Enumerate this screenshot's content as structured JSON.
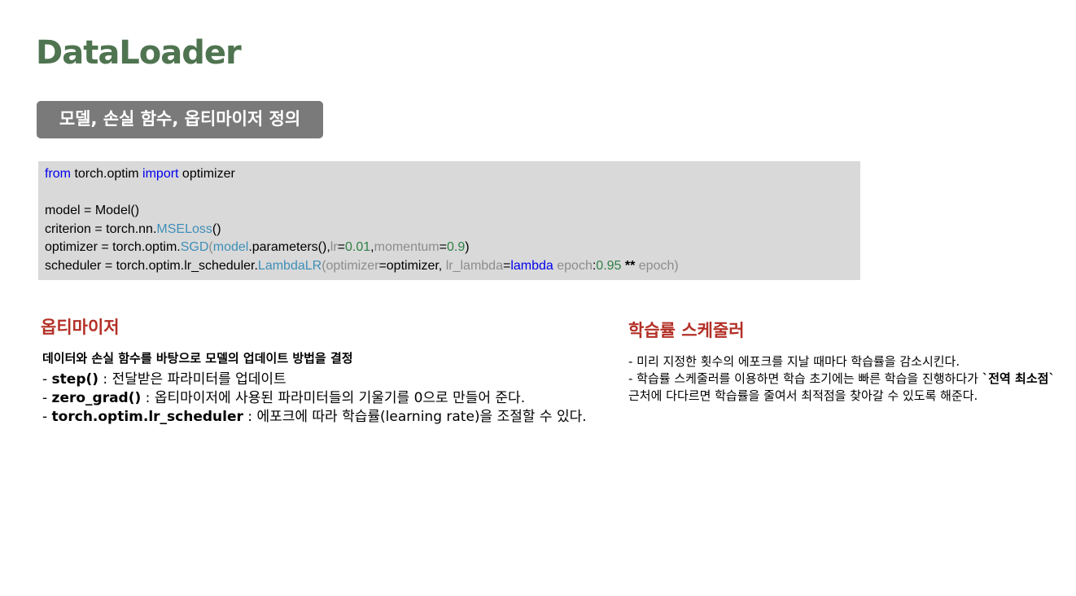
{
  "slide": {
    "title": "DataLoader",
    "badge": "모델, 손실 함수, 옵티마이저 정의"
  },
  "code": {
    "line1": {
      "kw_from": "from",
      "mod": " torch.optim ",
      "kw_import": "import",
      "name": " optimizer"
    },
    "line2": {
      "lhs": "model = Model()"
    },
    "line3": {
      "lhs": "criterion = torch.nn.",
      "fn": "MSELoss",
      "rest": "()"
    },
    "line4": {
      "lhs": "optimizer = torch.optim.",
      "fn": "SGD",
      "open": "(",
      "p_model": "model",
      "mid": ".parameters(),",
      "p_lr": "lr",
      "eq1": "=",
      "v_lr": "0.01",
      "comma": ",",
      "p_mom": "momentum",
      "eq2": "=",
      "v_mom": "0.9",
      "close": ")"
    },
    "line5": {
      "lhs": "scheduler = torch.optim.lr_scheduler.",
      "fn": "LambdaLR",
      "open": "(",
      "p_opt": "optimizer",
      "eq1": "=optimizer, ",
      "p_lambda": "lr_lambda",
      "eq2": "=",
      "kw_lambda": "lambda",
      "sp": " ",
      "p_epoch1": "epoch",
      "colon": ":",
      "v_base": "0.95",
      "pow": " ** ",
      "p_epoch2": "epoch",
      "close": ")"
    }
  },
  "left": {
    "heading": "옵티마이저",
    "summary": "데이터와 손실 함수를 바탕으로 모델의 업데이트 방법을 결정",
    "items": [
      {
        "dash": "- ",
        "term": "step()",
        "desc": "  : 전달받은 파라미터를 업데이트"
      },
      {
        "dash": "- ",
        "term": "zero_grad()",
        "desc": " : 옵티마이저에 사용된 파라미터들의 기울기를 0으로 만들어 준다."
      },
      {
        "dash": "- ",
        "term": "torch.optim.lr_scheduler",
        "desc": " : 에포크에 따라 학습률(learning rate)을 조절할 수 있다."
      }
    ]
  },
  "right": {
    "heading": "학습률 스케줄러",
    "line1": "- 미리 지정한 횟수의 에포크를 지날 때마다 학습률을 감소시킨다.",
    "line2_pre": "- 학습률 스케줄러를 이용하면 학습 초기에는 빠른 학습을 진행하다가 ",
    "line2_bold": "`전역 최소점`",
    "line2_post": " 근처에 다다르면 학습률을 줄여서 최적점을 찾아갈 수 있도록 해준다."
  }
}
